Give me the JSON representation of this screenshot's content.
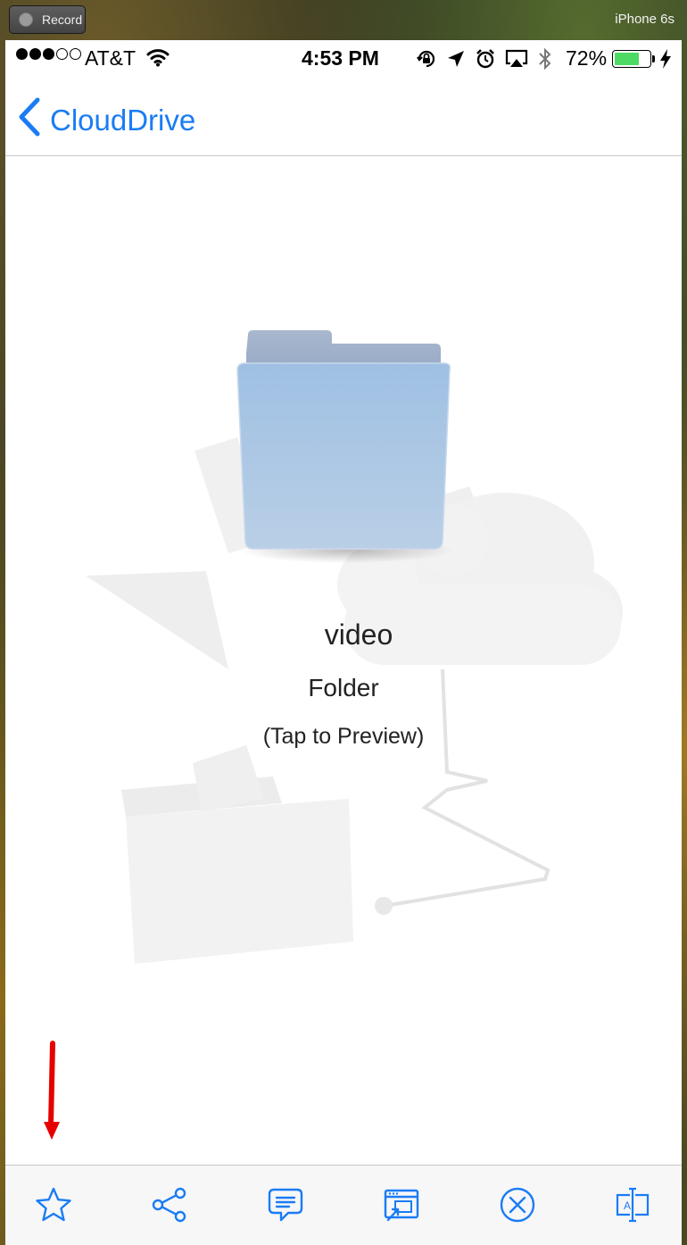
{
  "simulator": {
    "record_label": "Record",
    "device_name": "iPhone 6s"
  },
  "status_bar": {
    "carrier": "AT&T",
    "time": "4:53 PM",
    "battery": "72%",
    "battery_level": 0.72,
    "signal_bars_filled": 3,
    "signal_bars_total": 5
  },
  "nav": {
    "back_label": "CloudDrive"
  },
  "file": {
    "name": "video",
    "type": "Folder",
    "hint": "(Tap to Preview)"
  },
  "toolbar": {
    "icons": [
      "star-icon",
      "share-icon",
      "comment-icon",
      "open-in-icon",
      "close-circle-icon",
      "rename-icon"
    ]
  },
  "colors": {
    "accent": "#1a7cf5",
    "annotation_arrow": "#e60000",
    "battery_fill": "#4cd964"
  }
}
